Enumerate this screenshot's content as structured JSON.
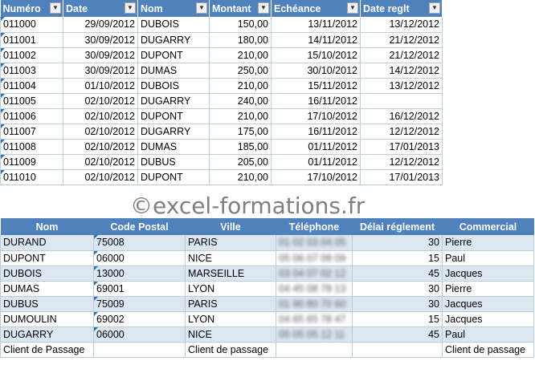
{
  "top_table": {
    "headers": [
      "Numéro",
      "Date",
      "Nom",
      "Montant",
      "Echéance",
      "Date reglt"
    ],
    "rows": [
      [
        "011000",
        "29/09/2012",
        "DUBOIS",
        "150,00",
        "13/11/2012",
        "13/12/2012"
      ],
      [
        "011001",
        "30/09/2012",
        "DUGARRY",
        "180,00",
        "14/11/2012",
        "21/12/2012"
      ],
      [
        "011002",
        "30/09/2012",
        "DUPONT",
        "210,00",
        "15/10/2012",
        "21/12/2012"
      ],
      [
        "011003",
        "30/09/2012",
        "DUMAS",
        "250,00",
        "30/10/2012",
        "14/12/2012"
      ],
      [
        "011004",
        "01/10/2012",
        "DUBOIS",
        "210,00",
        "15/11/2012",
        "13/12/2012"
      ],
      [
        "011005",
        "02/10/2012",
        "DUGARRY",
        "240,00",
        "16/11/2012",
        ""
      ],
      [
        "011006",
        "02/10/2012",
        "DUPONT",
        "210,00",
        "17/10/2012",
        "16/12/2012"
      ],
      [
        "011007",
        "02/10/2012",
        "DUGARRY",
        "175,00",
        "16/11/2012",
        "12/12/2012"
      ],
      [
        "011008",
        "02/10/2012",
        "DUMAS",
        "185,00",
        "01/11/2012",
        "17/01/2013"
      ],
      [
        "011009",
        "02/10/2012",
        "DUBUS",
        "205,00",
        "01/11/2012",
        "12/12/2012"
      ],
      [
        "011010",
        "02/10/2012",
        "DUPONT",
        "210,00",
        "17/10/2012",
        "17/01/2013"
      ]
    ]
  },
  "watermark": "©excel-formations.fr",
  "bottom_table": {
    "headers": [
      "Nom",
      "Code Postal",
      "Ville",
      "Téléphone",
      "Délai réglement",
      "Commercial"
    ],
    "rows": [
      [
        "DURAND",
        "75008",
        "PARIS",
        "01 02 03 04 05",
        "30",
        "Pierre"
      ],
      [
        "DUPONT",
        "06000",
        "NICE",
        "05 06 07 08 09",
        "15",
        "Paul"
      ],
      [
        "DUBOIS",
        "13000",
        "MARSEILLE",
        "03 04 07 02 12",
        "45",
        "Jacques"
      ],
      [
        "DUMAS",
        "69001",
        "LYON",
        "04 45 08 78 13",
        "30",
        "Pierre"
      ],
      [
        "DUBUS",
        "75009",
        "PARIS",
        "01 90 80 70 60",
        "30",
        "Jacques"
      ],
      [
        "DUMOULIN",
        "69002",
        "LYON",
        "04 65 65 78 47",
        "15",
        "Jacques"
      ],
      [
        "DUGARRY",
        "06000",
        "NICE",
        "05 05 05 12 11",
        "45",
        "Paul"
      ],
      [
        "Client de Passage",
        "",
        "Client de passage",
        "",
        "",
        "Client de passage"
      ]
    ]
  }
}
